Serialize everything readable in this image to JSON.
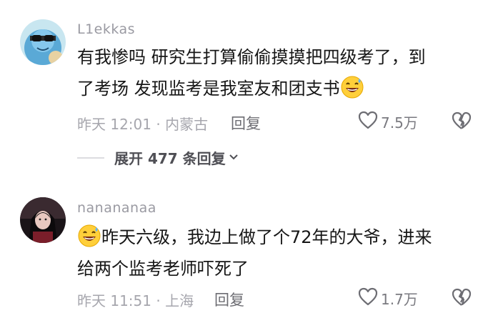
{
  "comments": [
    {
      "username": "L1ekkas",
      "lines": [
        "有我惨吗  研究生打算偷偷摸摸把四级考了，到",
        "了考场 发现监考是我室友和团支书"
      ],
      "timestamp": "昨天 12:01 · 内蒙古",
      "reply_label": "回复",
      "likes": "7.5万",
      "emoji": "grinning-sweat-emoji",
      "expand_label": "展开 477 条回复"
    },
    {
      "username": "nanananaa",
      "lines": [
        "昨天六级，我边上做了个72年的大爷，进来",
        "给两个监考老师吓死了"
      ],
      "timestamp": "昨天 11:51 · 上海",
      "reply_label": "回复",
      "likes": "1.7万",
      "emoji": "grinning-sweat-emoji"
    }
  ],
  "icons": {
    "like": "heart-outline-icon",
    "dislike": "broken-heart-icon",
    "expand": "chevron-down-icon"
  },
  "colors": {
    "username": "#9a9aa2",
    "meta": "#a6a6ad",
    "text": "#161616"
  }
}
